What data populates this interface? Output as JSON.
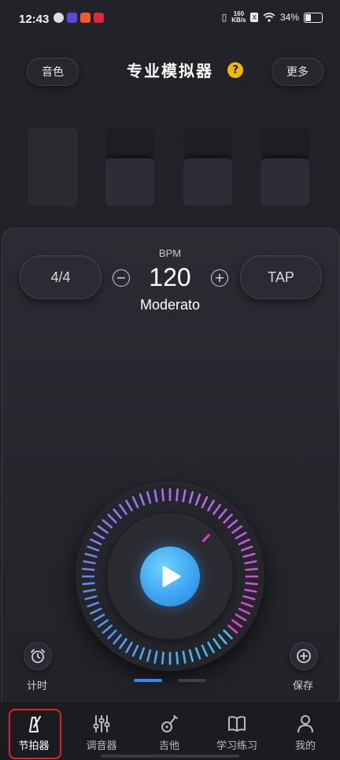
{
  "status_bar": {
    "time": "12:43",
    "network_speed_top": "160",
    "network_speed_unit": "KB/s",
    "battery": "34%"
  },
  "header": {
    "left_button": "音色",
    "title": "专业模拟器",
    "help_icon": "?",
    "right_button": "更多"
  },
  "metronome": {
    "time_signature": "4/4",
    "bpm_label": "BPM",
    "bpm_value": "120",
    "minus": "−",
    "plus": "+",
    "tempo_name": "Moderato",
    "tap_label": "TAP",
    "progress": 0.62
  },
  "actions": {
    "timer_label": "计时",
    "save_label": "保存"
  },
  "colors": {
    "accent_blue": "#3ea6f2",
    "accent_purple": "#b36cf0",
    "accent_pink": "#e040c8",
    "highlight_red": "#e1222a"
  },
  "tabbar": {
    "tabs": [
      {
        "label": "节拍器",
        "icon": "metronome-icon"
      },
      {
        "label": "调音器",
        "icon": "sliders-icon"
      },
      {
        "label": "吉他",
        "icon": "guitar-icon"
      },
      {
        "label": "学习练习",
        "icon": "book-icon"
      },
      {
        "label": "我的",
        "icon": "person-icon"
      }
    ]
  }
}
